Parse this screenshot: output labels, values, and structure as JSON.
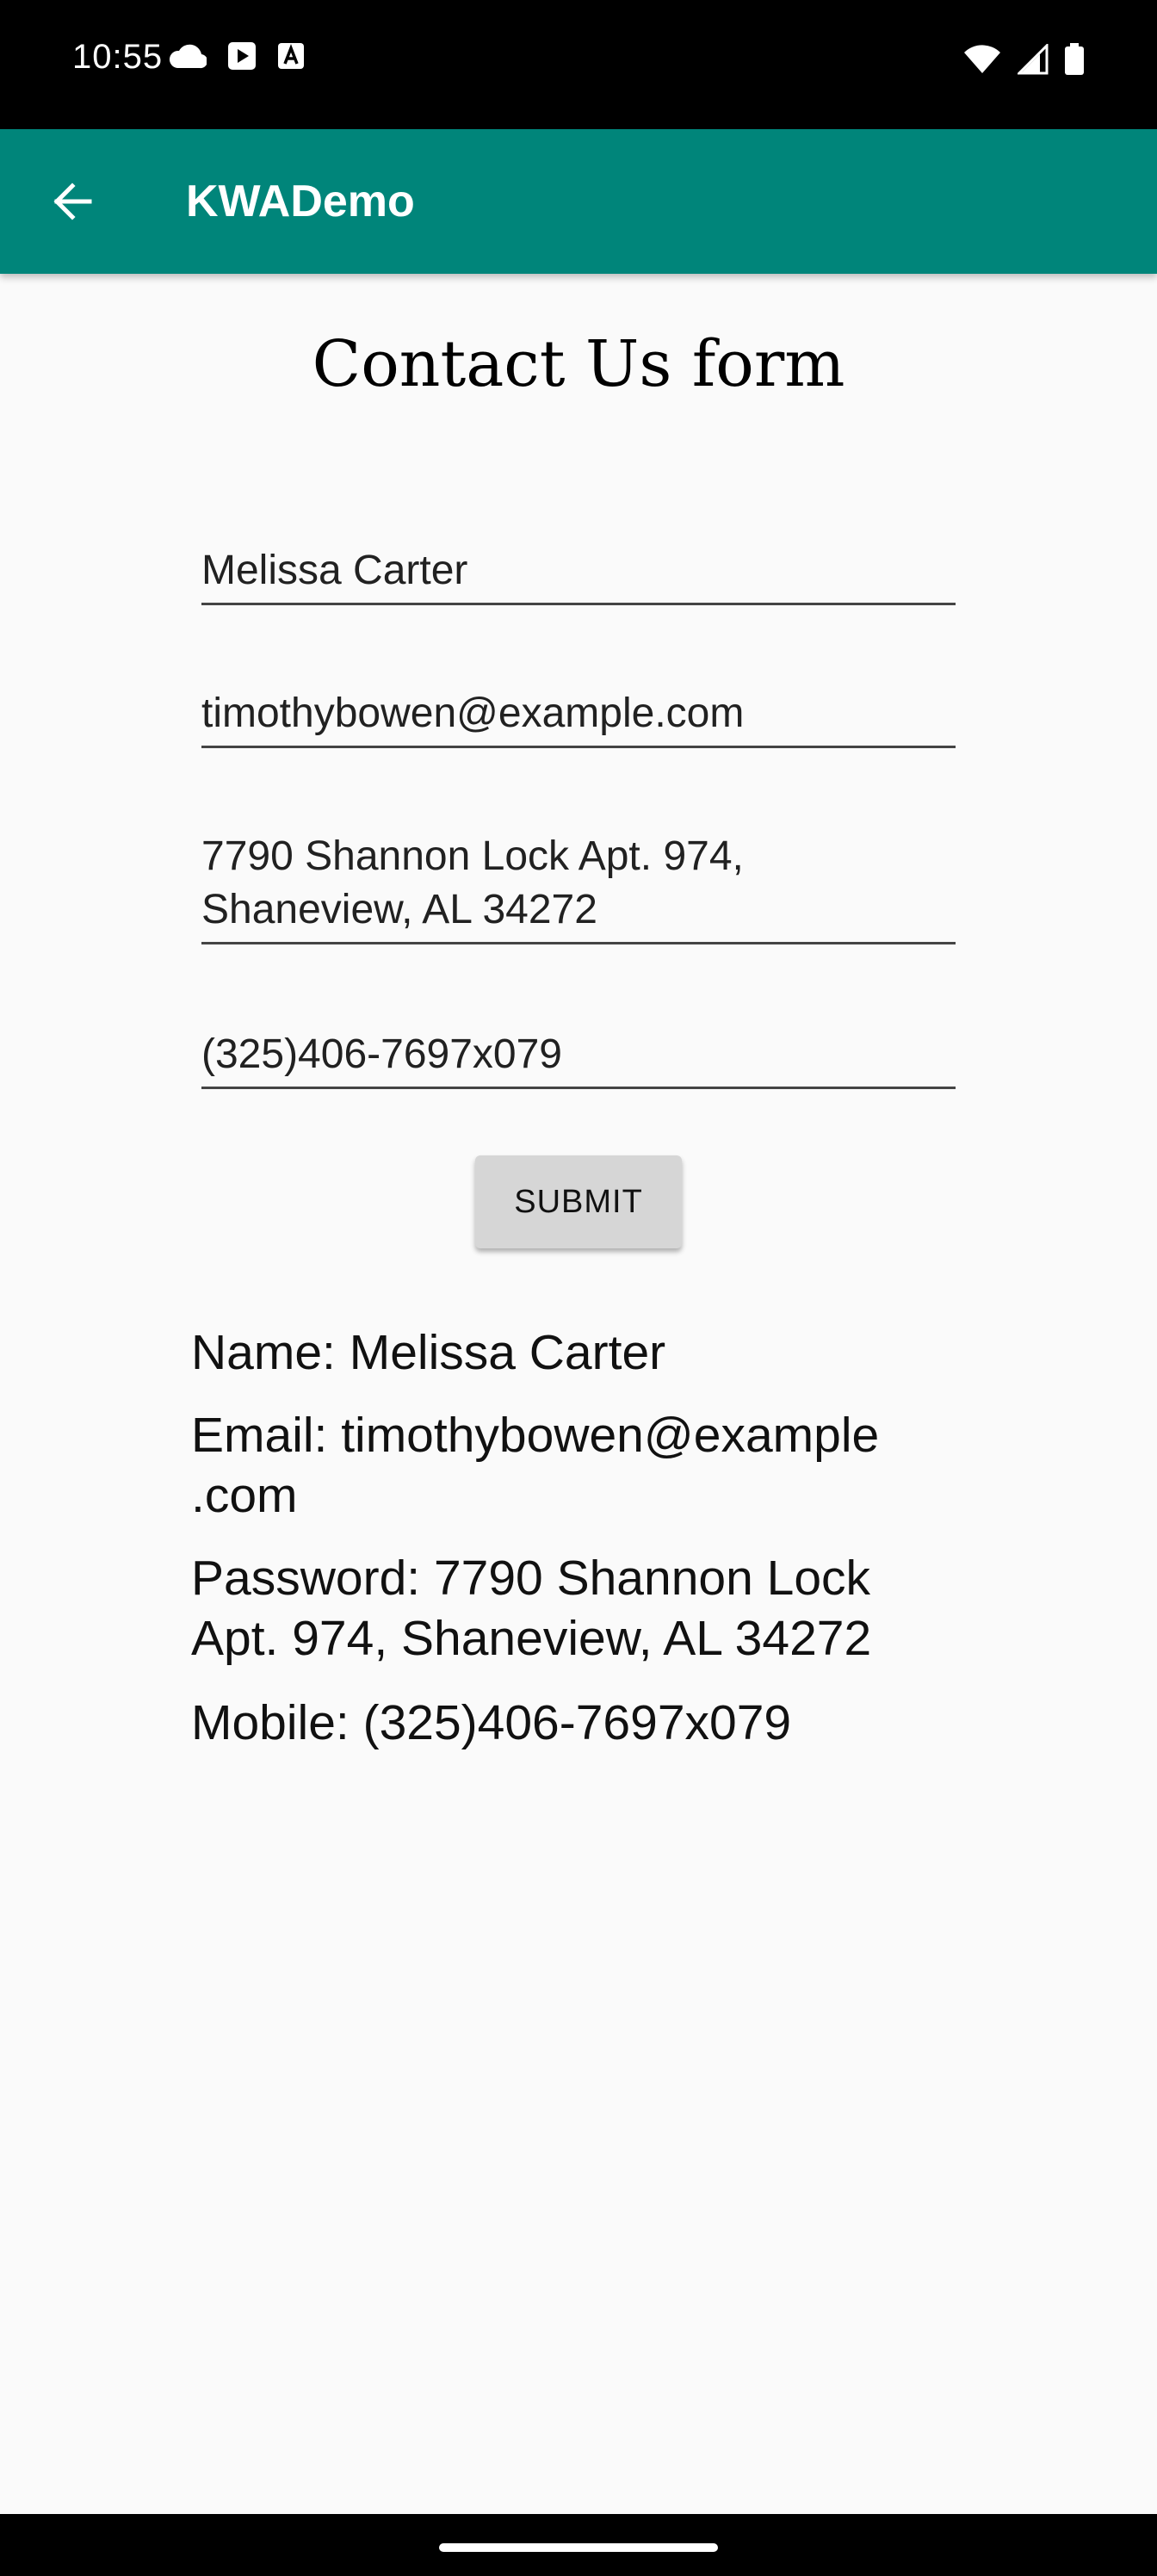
{
  "status_bar": {
    "time": "10:55",
    "notification_icons": [
      "cloud-icon",
      "play-icon",
      "a-icon"
    ],
    "system_icons": [
      "wifi-icon",
      "signal-icon",
      "battery-icon"
    ]
  },
  "app_bar": {
    "title": "KWADemo",
    "background_color": "#00857a"
  },
  "form": {
    "title": "Contact Us form",
    "name_value": "Melissa Carter",
    "email_value": "timothybowen@example.com",
    "address_line1": "7790 Shannon Lock Apt. 974,",
    "address_line2": "Shaneview, AL 34272",
    "mobile_value": "(325)406-7697x079",
    "submit_label": "SUBMIT"
  },
  "output": {
    "name": "Name: Melissa Carter",
    "email_line1": "Email: timothybowen@example",
    "email_line2": ".com",
    "password_line1": "Password: 7790 Shannon Lock",
    "password_line2": "Apt. 974, Shaneview, AL 34272",
    "mobile": "Mobile: (325)406-7697x079"
  }
}
